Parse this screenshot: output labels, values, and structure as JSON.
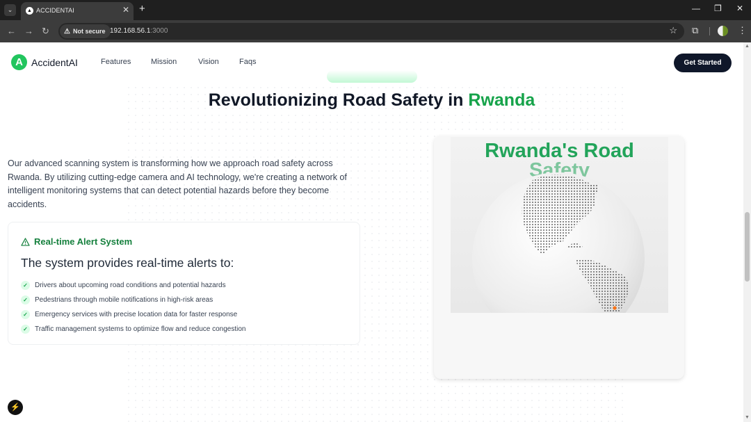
{
  "browser": {
    "tab_title": "ACCIDENTAI",
    "tab_favicon": "vercel-triangle-icon",
    "security_label": "Not secure",
    "url_host": "192.168.56.1",
    "url_port": ":3000"
  },
  "site": {
    "logo_letter": "A",
    "logo_text": "AccidentAI",
    "nav": [
      "Features",
      "Mission",
      "Vision",
      "Faqs"
    ],
    "cta_label": "Get Started"
  },
  "hero": {
    "headline_main": "Revolutionizing Road Safety in ",
    "headline_accent": "Rwanda",
    "intro": "Our advanced scanning system is transforming how we approach road safety across Rwanda. By utilizing cutting-edge camera and AI technology, we're creating a network of intelligent monitoring systems that can detect potential hazards before they become accidents."
  },
  "alert_card": {
    "title": "Real-time Alert System",
    "subtitle": "The system provides real-time alerts to:",
    "items": [
      "Drivers about upcoming road conditions and potential hazards",
      "Pedestrians through mobile notifications in high-risk areas",
      "Emergency services with precise location data for faster response",
      "Traffic management systems to optimize flow and reduce congestion"
    ]
  },
  "globe_card": {
    "title_line1": "Rwanda's Road",
    "title_line2": "Safety"
  },
  "colors": {
    "accent": "#16a34a",
    "dark_button": "#0f172a",
    "logo_green": "#22c55e"
  }
}
